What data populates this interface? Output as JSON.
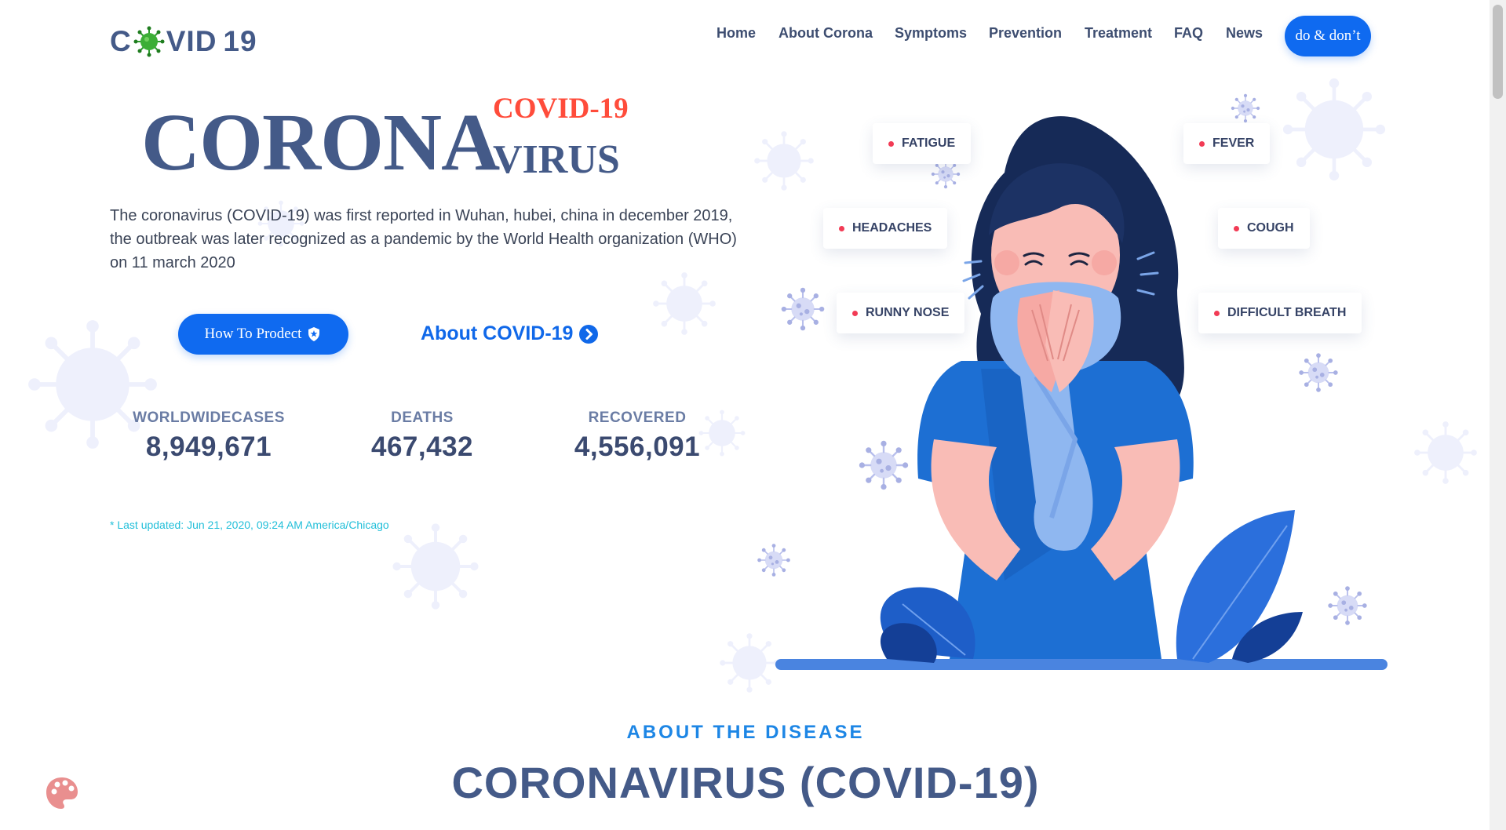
{
  "brand": {
    "logo_c": "C",
    "logo_vid": "VID",
    "logo_num": "19",
    "virus_icon": "virus-icon"
  },
  "nav": {
    "items": [
      {
        "label": "Home"
      },
      {
        "label": "About Corona"
      },
      {
        "label": "Symptoms"
      },
      {
        "label": "Prevention"
      },
      {
        "label": "Treatment"
      },
      {
        "label": "FAQ"
      },
      {
        "label": "News"
      }
    ],
    "cta_label": "do & don’t"
  },
  "hero": {
    "title_big": "CORONA",
    "title_covid": "COVID-19",
    "title_virus": "VIRUS",
    "description": "The coronavirus (COVID-19) was first reported in Wuhan, hubei, china in december 2019, the outbreak was later recognized as a pandemic by the World Health organization (WHO) on 11 march 2020",
    "protect_button": "How To Prodect",
    "protect_icon": "shield-icon",
    "about_link": "About COVID-19",
    "about_icon": "chevron-right-circle-icon"
  },
  "stats": [
    {
      "label": "WORLDWIDECASES",
      "value": "8,949,671"
    },
    {
      "label": "DEATHS",
      "value": "467,432"
    },
    {
      "label": "RECOVERED",
      "value": "4,556,091"
    }
  ],
  "last_updated": "* Last updated: Jun 21, 2020, 09:24 AM America/Chicago",
  "symptoms": [
    {
      "label": "FATIGUE"
    },
    {
      "label": "FEVER"
    },
    {
      "label": "HEADACHES"
    },
    {
      "label": "COUGH"
    },
    {
      "label": "RUNNY NOSE"
    },
    {
      "label": "DIFFICULT BREATH"
    }
  ],
  "about": {
    "kicker": "ABOUT THE DISEASE",
    "title": "CORONAVIRUS (COVID-19)"
  },
  "colors": {
    "accent": "#0f6af0",
    "title": "#445a88",
    "red": "#ff4c3b",
    "kicker": "#1d86e5",
    "updated": "#22bfd9"
  },
  "widgets": {
    "palette_icon": "palette-icon"
  }
}
